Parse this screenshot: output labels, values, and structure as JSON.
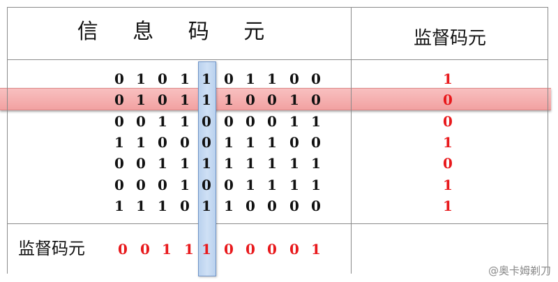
{
  "header": {
    "info_title": "信 息 码 元",
    "check_title": "监督码元"
  },
  "matrix": [
    [
      0,
      1,
      0,
      1,
      1,
      0,
      1,
      1,
      0,
      0
    ],
    [
      0,
      1,
      0,
      1,
      1,
      1,
      0,
      0,
      1,
      0
    ],
    [
      0,
      0,
      1,
      1,
      0,
      0,
      0,
      0,
      1,
      1
    ],
    [
      1,
      1,
      0,
      0,
      0,
      1,
      1,
      1,
      0,
      0
    ],
    [
      0,
      0,
      1,
      1,
      1,
      1,
      1,
      1,
      1,
      1
    ],
    [
      0,
      0,
      0,
      1,
      0,
      0,
      1,
      1,
      1,
      1
    ],
    [
      1,
      1,
      1,
      0,
      1,
      1,
      0,
      0,
      0,
      0
    ]
  ],
  "row_checks": [
    1,
    0,
    0,
    1,
    0,
    1,
    1
  ],
  "bottom": {
    "label": "监督码元",
    "col_checks": [
      0,
      0,
      1,
      1,
      1,
      0,
      0,
      0,
      0,
      1
    ]
  },
  "highlight": {
    "row_index": 1,
    "col_index": 4
  },
  "colors": {
    "check_bits": "#e8191c",
    "row_highlight": "#f5b3b3",
    "col_highlight": "#c3d8f1"
  },
  "watermark": "@奥卡姆剃刀"
}
